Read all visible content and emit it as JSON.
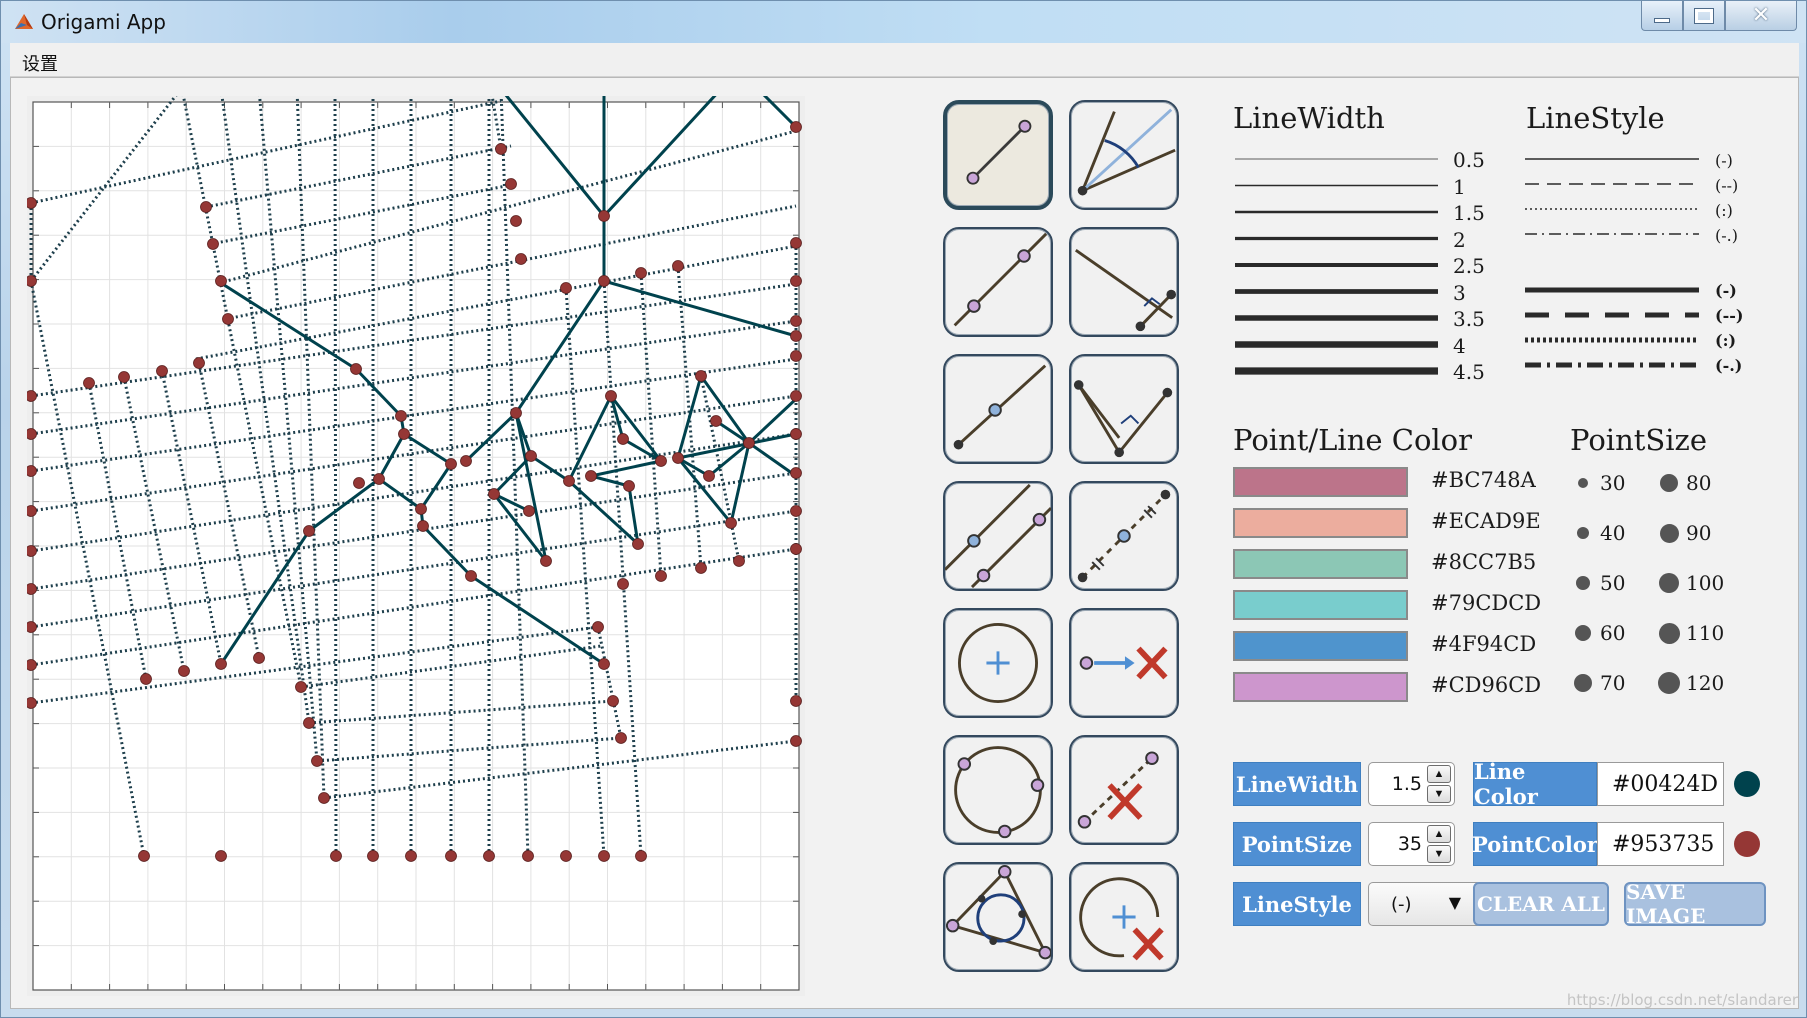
{
  "window": {
    "title": "Origami App",
    "controls": {
      "minimize": "—",
      "maximize": "□",
      "close": "✕"
    }
  },
  "menu": {
    "items": [
      "设置"
    ]
  },
  "tools": [
    {
      "name": "two-point-line-tool-icon",
      "selected": true
    },
    {
      "name": "angle-bisector-tool-icon",
      "selected": false
    },
    {
      "name": "line-through-two-points-tool-icon",
      "selected": false
    },
    {
      "name": "perpendicular-foot-tool-icon",
      "selected": false
    },
    {
      "name": "midpoint-line-tool-icon",
      "selected": false
    },
    {
      "name": "perpendicular-line-tool-icon",
      "selected": false
    },
    {
      "name": "parallel-line-tool-icon",
      "selected": false
    },
    {
      "name": "perpendicular-bisector-tool-icon",
      "selected": false
    },
    {
      "name": "circle-center-tool-icon",
      "selected": false
    },
    {
      "name": "delete-point-tool-icon",
      "selected": false
    },
    {
      "name": "three-point-circle-tool-icon",
      "selected": false
    },
    {
      "name": "delete-line-tool-icon",
      "selected": false
    },
    {
      "name": "inscribed-circle-tool-icon",
      "selected": false
    },
    {
      "name": "delete-circle-tool-icon",
      "selected": false
    }
  ],
  "legend": {
    "linewidth_title": "LineWidth",
    "linewidths": [
      "0.5",
      "1",
      "1.5",
      "2",
      "2.5",
      "3",
      "3.5",
      "4",
      "4.5"
    ],
    "linestyle_title": "LineStyle",
    "linestyles_thin": [
      "(-)",
      "(--)",
      "(:)",
      "(-.)"
    ],
    "linestyles_thick": [
      "(-)",
      "(--)",
      "(:)",
      "(-.)"
    ],
    "color_title": "Point/Line Color",
    "colors": [
      "#BC748A",
      "#ECAD9E",
      "#8CC7B5",
      "#79CDCD",
      "#4F94CD",
      "#CD96CD"
    ],
    "pointsize_title": "PointSize",
    "pointsizes_left": [
      "30",
      "40",
      "50",
      "60",
      "70"
    ],
    "pointsizes_right": [
      "80",
      "90",
      "100",
      "110",
      "120"
    ]
  },
  "controls": {
    "linewidth_label": "LineWidth",
    "linewidth_value": "1.5",
    "pointsize_label": "PointSize",
    "pointsize_value": "35",
    "linestyle_label": "LineStyle",
    "linestyle_value": "(-)",
    "linecolor_label": "Line Color",
    "linecolor_value": "#00424D",
    "pointcolor_label": "PointColor",
    "pointcolor_value": "#953735",
    "clear_label": "CLEAR ALL",
    "save_label": "SAVE IMAGE",
    "spin_up": "▲",
    "spin_down": "▼",
    "dropdown_arrow": "▼"
  },
  "watermark": "https://blog.csdn.net/slandarer",
  "colors": {
    "line": "#00424D",
    "point": "#953735",
    "button": "#4F8FD3"
  }
}
